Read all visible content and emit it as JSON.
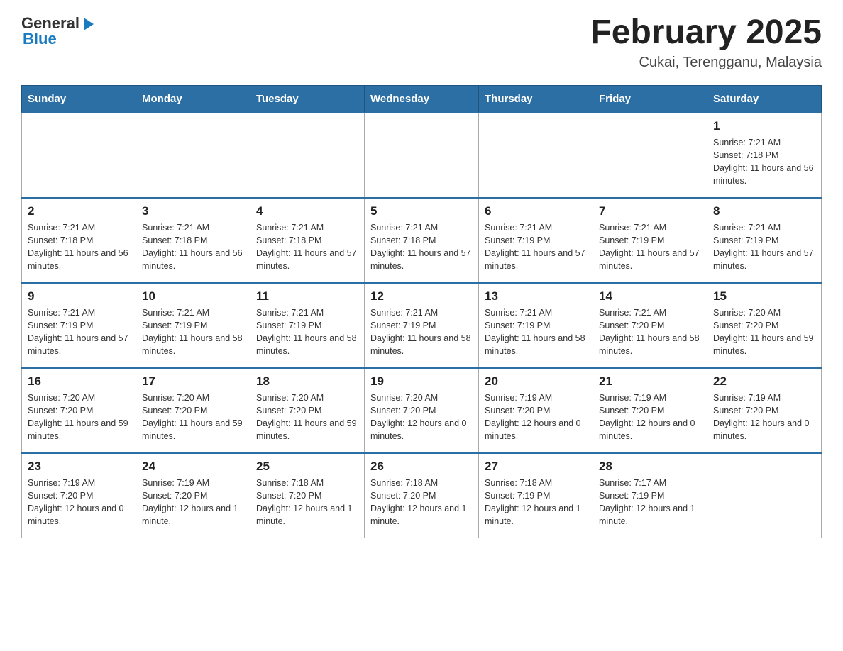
{
  "header": {
    "logo": {
      "general": "General",
      "arrow": "▶",
      "blue": "Blue"
    },
    "title": "February 2025",
    "subtitle": "Cukai, Terengganu, Malaysia"
  },
  "days_of_week": [
    "Sunday",
    "Monday",
    "Tuesday",
    "Wednesday",
    "Thursday",
    "Friday",
    "Saturday"
  ],
  "weeks": [
    [
      {
        "day": "",
        "sunrise": "",
        "sunset": "",
        "daylight": ""
      },
      {
        "day": "",
        "sunrise": "",
        "sunset": "",
        "daylight": ""
      },
      {
        "day": "",
        "sunrise": "",
        "sunset": "",
        "daylight": ""
      },
      {
        "day": "",
        "sunrise": "",
        "sunset": "",
        "daylight": ""
      },
      {
        "day": "",
        "sunrise": "",
        "sunset": "",
        "daylight": ""
      },
      {
        "day": "",
        "sunrise": "",
        "sunset": "",
        "daylight": ""
      },
      {
        "day": "1",
        "sunrise": "Sunrise: 7:21 AM",
        "sunset": "Sunset: 7:18 PM",
        "daylight": "Daylight: 11 hours and 56 minutes."
      }
    ],
    [
      {
        "day": "2",
        "sunrise": "Sunrise: 7:21 AM",
        "sunset": "Sunset: 7:18 PM",
        "daylight": "Daylight: 11 hours and 56 minutes."
      },
      {
        "day": "3",
        "sunrise": "Sunrise: 7:21 AM",
        "sunset": "Sunset: 7:18 PM",
        "daylight": "Daylight: 11 hours and 56 minutes."
      },
      {
        "day": "4",
        "sunrise": "Sunrise: 7:21 AM",
        "sunset": "Sunset: 7:18 PM",
        "daylight": "Daylight: 11 hours and 57 minutes."
      },
      {
        "day": "5",
        "sunrise": "Sunrise: 7:21 AM",
        "sunset": "Sunset: 7:18 PM",
        "daylight": "Daylight: 11 hours and 57 minutes."
      },
      {
        "day": "6",
        "sunrise": "Sunrise: 7:21 AM",
        "sunset": "Sunset: 7:19 PM",
        "daylight": "Daylight: 11 hours and 57 minutes."
      },
      {
        "day": "7",
        "sunrise": "Sunrise: 7:21 AM",
        "sunset": "Sunset: 7:19 PM",
        "daylight": "Daylight: 11 hours and 57 minutes."
      },
      {
        "day": "8",
        "sunrise": "Sunrise: 7:21 AM",
        "sunset": "Sunset: 7:19 PM",
        "daylight": "Daylight: 11 hours and 57 minutes."
      }
    ],
    [
      {
        "day": "9",
        "sunrise": "Sunrise: 7:21 AM",
        "sunset": "Sunset: 7:19 PM",
        "daylight": "Daylight: 11 hours and 57 minutes."
      },
      {
        "day": "10",
        "sunrise": "Sunrise: 7:21 AM",
        "sunset": "Sunset: 7:19 PM",
        "daylight": "Daylight: 11 hours and 58 minutes."
      },
      {
        "day": "11",
        "sunrise": "Sunrise: 7:21 AM",
        "sunset": "Sunset: 7:19 PM",
        "daylight": "Daylight: 11 hours and 58 minutes."
      },
      {
        "day": "12",
        "sunrise": "Sunrise: 7:21 AM",
        "sunset": "Sunset: 7:19 PM",
        "daylight": "Daylight: 11 hours and 58 minutes."
      },
      {
        "day": "13",
        "sunrise": "Sunrise: 7:21 AM",
        "sunset": "Sunset: 7:19 PM",
        "daylight": "Daylight: 11 hours and 58 minutes."
      },
      {
        "day": "14",
        "sunrise": "Sunrise: 7:21 AM",
        "sunset": "Sunset: 7:20 PM",
        "daylight": "Daylight: 11 hours and 58 minutes."
      },
      {
        "day": "15",
        "sunrise": "Sunrise: 7:20 AM",
        "sunset": "Sunset: 7:20 PM",
        "daylight": "Daylight: 11 hours and 59 minutes."
      }
    ],
    [
      {
        "day": "16",
        "sunrise": "Sunrise: 7:20 AM",
        "sunset": "Sunset: 7:20 PM",
        "daylight": "Daylight: 11 hours and 59 minutes."
      },
      {
        "day": "17",
        "sunrise": "Sunrise: 7:20 AM",
        "sunset": "Sunset: 7:20 PM",
        "daylight": "Daylight: 11 hours and 59 minutes."
      },
      {
        "day": "18",
        "sunrise": "Sunrise: 7:20 AM",
        "sunset": "Sunset: 7:20 PM",
        "daylight": "Daylight: 11 hours and 59 minutes."
      },
      {
        "day": "19",
        "sunrise": "Sunrise: 7:20 AM",
        "sunset": "Sunset: 7:20 PM",
        "daylight": "Daylight: 12 hours and 0 minutes."
      },
      {
        "day": "20",
        "sunrise": "Sunrise: 7:19 AM",
        "sunset": "Sunset: 7:20 PM",
        "daylight": "Daylight: 12 hours and 0 minutes."
      },
      {
        "day": "21",
        "sunrise": "Sunrise: 7:19 AM",
        "sunset": "Sunset: 7:20 PM",
        "daylight": "Daylight: 12 hours and 0 minutes."
      },
      {
        "day": "22",
        "sunrise": "Sunrise: 7:19 AM",
        "sunset": "Sunset: 7:20 PM",
        "daylight": "Daylight: 12 hours and 0 minutes."
      }
    ],
    [
      {
        "day": "23",
        "sunrise": "Sunrise: 7:19 AM",
        "sunset": "Sunset: 7:20 PM",
        "daylight": "Daylight: 12 hours and 0 minutes."
      },
      {
        "day": "24",
        "sunrise": "Sunrise: 7:19 AM",
        "sunset": "Sunset: 7:20 PM",
        "daylight": "Daylight: 12 hours and 1 minute."
      },
      {
        "day": "25",
        "sunrise": "Sunrise: 7:18 AM",
        "sunset": "Sunset: 7:20 PM",
        "daylight": "Daylight: 12 hours and 1 minute."
      },
      {
        "day": "26",
        "sunrise": "Sunrise: 7:18 AM",
        "sunset": "Sunset: 7:20 PM",
        "daylight": "Daylight: 12 hours and 1 minute."
      },
      {
        "day": "27",
        "sunrise": "Sunrise: 7:18 AM",
        "sunset": "Sunset: 7:19 PM",
        "daylight": "Daylight: 12 hours and 1 minute."
      },
      {
        "day": "28",
        "sunrise": "Sunrise: 7:17 AM",
        "sunset": "Sunset: 7:19 PM",
        "daylight": "Daylight: 12 hours and 1 minute."
      },
      {
        "day": "",
        "sunrise": "",
        "sunset": "",
        "daylight": ""
      }
    ]
  ]
}
